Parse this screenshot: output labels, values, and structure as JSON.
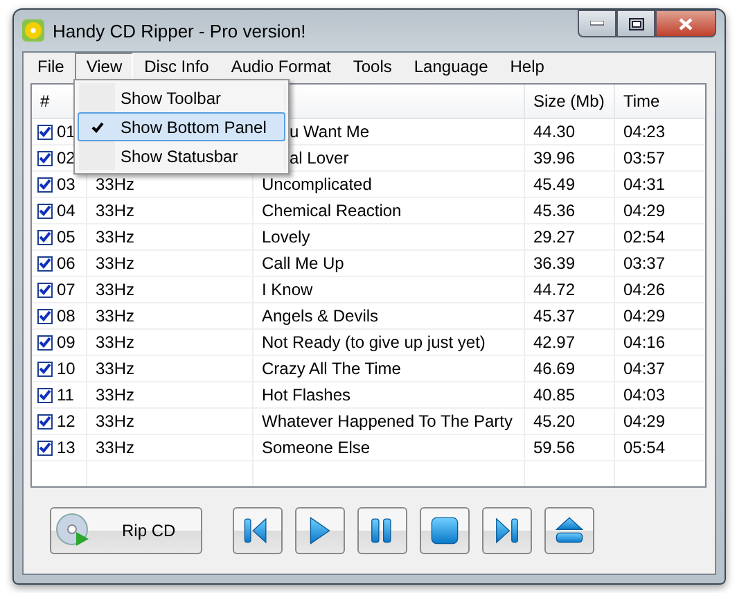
{
  "window": {
    "title": "Handy CD Ripper - Pro version!"
  },
  "menu": [
    {
      "label": "File",
      "selected": false
    },
    {
      "label": "View",
      "selected": true
    },
    {
      "label": "Disc Info",
      "selected": false
    },
    {
      "label": "Audio Format",
      "selected": false
    },
    {
      "label": "Tools",
      "selected": false
    },
    {
      "label": "Language",
      "selected": false
    },
    {
      "label": "Help",
      "selected": false
    }
  ],
  "dropdown": [
    {
      "label": "Show Toolbar",
      "checked": false,
      "selected": false
    },
    {
      "label": "Show Bottom Panel",
      "checked": true,
      "selected": true
    },
    {
      "label": "Show Statusbar",
      "checked": false,
      "selected": false
    }
  ],
  "table": {
    "columns": [
      "#",
      "Size (Mb)",
      "Time"
    ],
    "rows": [
      {
        "checked": true,
        "number": "01",
        "title": "u Want Me",
        "size": "44.30",
        "time": "04:23",
        "covered": true
      },
      {
        "checked": true,
        "number": "02",
        "title": "al Lover",
        "size": "39.96",
        "time": "03:57",
        "covered": true
      },
      {
        "checked": true,
        "number": "03",
        "column_2": "33Hz",
        "title": "Uncomplicated",
        "size": "45.49",
        "time": "04:31"
      },
      {
        "checked": true,
        "number": "04",
        "column_2": "33Hz",
        "title": "Chemical Reaction",
        "size": "45.36",
        "time": "04:29"
      },
      {
        "checked": true,
        "number": "05",
        "column_2": "33Hz",
        "title": "Lovely",
        "size": "29.27",
        "time": "02:54"
      },
      {
        "checked": true,
        "number": "06",
        "column_2": "33Hz",
        "title": "Call Me Up",
        "size": "36.39",
        "time": "03:37"
      },
      {
        "checked": true,
        "number": "07",
        "column_2": "33Hz",
        "title": "I Know",
        "size": "44.72",
        "time": "04:26"
      },
      {
        "checked": true,
        "number": "08",
        "column_2": "33Hz",
        "title": "Angels & Devils",
        "size": "45.37",
        "time": "04:29"
      },
      {
        "checked": true,
        "number": "09",
        "column_2": "33Hz",
        "title": "Not Ready (to give up just yet)",
        "size": "42.97",
        "time": "04:16"
      },
      {
        "checked": true,
        "number": "10",
        "column_2": "33Hz",
        "title": "Crazy All The Time",
        "size": "46.69",
        "time": "04:37"
      },
      {
        "checked": true,
        "number": "11",
        "column_2": "33Hz",
        "title": "Hot Flashes",
        "size": "40.85",
        "time": "04:03"
      },
      {
        "checked": true,
        "number": "12",
        "column_2": "33Hz",
        "title": "Whatever Happened To The Party",
        "size": "45.20",
        "time": "04:29"
      },
      {
        "checked": true,
        "number": "13",
        "column_2": "33Hz",
        "title": "Someone Else",
        "size": "59.56",
        "time": "05:54"
      }
    ]
  },
  "bottom_panel": {
    "rip_button": "Rip CD",
    "transport": [
      {
        "kind": "previous"
      },
      {
        "kind": "play"
      },
      {
        "kind": "pause"
      },
      {
        "kind": "stop"
      },
      {
        "kind": "next"
      },
      {
        "kind": "eject"
      }
    ]
  }
}
